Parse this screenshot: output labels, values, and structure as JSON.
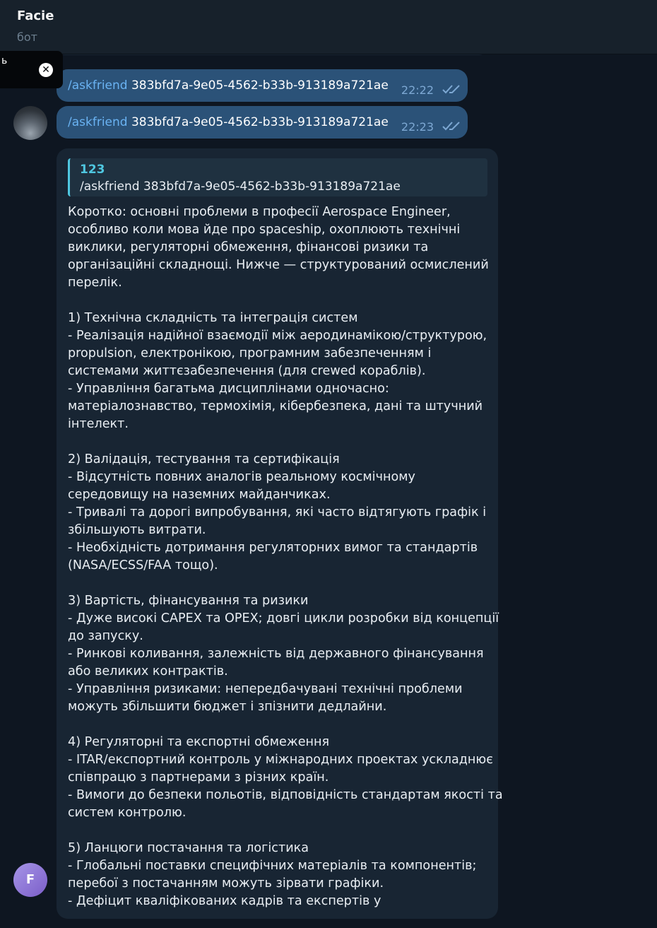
{
  "header": {
    "title": "Facie",
    "subtitle": "бот"
  },
  "popup": {
    "text": "ь",
    "close_icon": "close-icon"
  },
  "messages_out": [
    {
      "command": "/askfriend",
      "argument": "383bfd7a-9e05-4562-b33b-913189a721ae",
      "time": "22:22",
      "status_icon": "double-check-icon"
    },
    {
      "command": "/askfriend",
      "argument": "383bfd7a-9e05-4562-b33b-913189a721ae",
      "time": "22:23",
      "status_icon": "double-check-icon"
    }
  ],
  "bot_message": {
    "reply": {
      "name": "123",
      "text": "/askfriend 383bfd7a-9e05-4562-b33b-913189a721ae"
    },
    "paragraphs": [
      [
        "Коротко: основні проблеми в професії Aerospace Engineer,",
        "особливо коли мова йде про spaceship, охоплюють технічні",
        "виклики, регуляторні обмеження, фінансові ризики та",
        "організаційні складнощі. Нижче — структурований осмислений",
        "перелік."
      ],
      [
        "1) Технічна складність та інтеграція систем",
        "- Реалізація надійної взаємодії між аеродинамікою/структурою,",
        "propulsion, електронікою, програмним забезпеченням і",
        "системами життєзабезпечення (для crewed кораблів).",
        "- Управління багатьма дисциплінами одночасно:",
        "матеріалознавство, термохімія, кібербезпека, дані та штучний",
        "інтелект."
      ],
      [
        "2) Валідація, тестування та сертифікація",
        "- Відсутність повних аналогів реальному космічному",
        "середовищу на наземних майданчиках.",
        "- Тривалі та дорогі випробування, які часто відтягують графік і",
        "збільшують витрати.",
        "- Необхідність дотримання регуляторних вимог та стандартів",
        "(NASA/ECSS/FAA тощо)."
      ],
      [
        "3) Вартість, фінансування та ризики",
        "- Дуже високі CAPEX та OPEX; довгі цикли розробки від концепції",
        "до запуску.",
        "- Ринкові коливання, залежність від державного фінансування",
        "або великих контрактів.",
        "- Управління ризиками: непередбачувані технічні проблеми",
        "можуть збільшити бюджет і зпізнити дедлайни."
      ],
      [
        "4) Регуляторні та експортні обмеження",
        "- ITAR/експортний контроль у міжнародних проектах ускладнює",
        "співпрацю з партнерами з різних країн.",
        "- Вимоги до безпеки польотів, відповідність стандартам якості та",
        "систем контролю."
      ],
      [
        "5) Ланцюги постачання та логістика",
        "- Глобальні поставки специфічних матеріалів та компонентів;",
        "перебої з постачанням можуть зірвати графіки.",
        "- Дефіцит кваліфікованих кадрів та експертів у"
      ]
    ]
  },
  "bot_avatar": {
    "letter": "F"
  },
  "colors": {
    "background": "#0e1621",
    "header": "#17212b",
    "outgoing_bubble": "#2b5278",
    "incoming_bubble": "#182533",
    "accent": "#4fc7e0",
    "command_link": "#6ab3f3",
    "avatar_f": "#8b6fd8"
  }
}
